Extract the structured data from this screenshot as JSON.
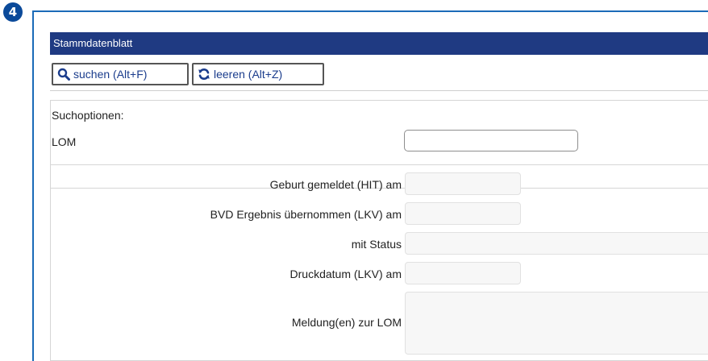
{
  "step": {
    "number": "4"
  },
  "panel": {
    "title": "Stammdatenblatt"
  },
  "toolbar": {
    "search_label": "suchen (Alt+F)",
    "clear_label": "leeren (Alt+Z)"
  },
  "search_options": {
    "heading": "Suchoptionen:",
    "lom_label": "LOM",
    "lom_value": ""
  },
  "results": {
    "birth_reported_label": "Geburt gemeldet (HIT) am",
    "bvd_result_label": "BVD Ergebnis übernommen (LKV) am",
    "status_label": "mit Status",
    "print_date_label": "Druckdatum (LKV) am",
    "messages_label": "Meldung(en) zur LOM"
  },
  "colors": {
    "title_bar": "#1f3a82",
    "frame": "#1b6bb8",
    "badge": "#0b4a9a",
    "button_text": "#1a3c8c"
  }
}
